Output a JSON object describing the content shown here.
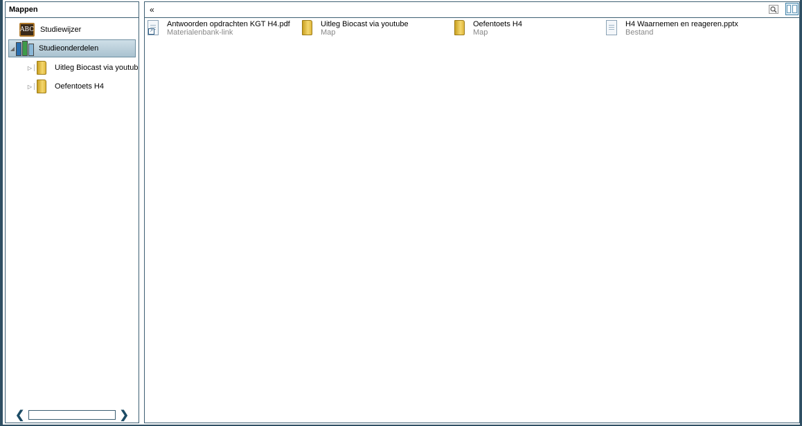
{
  "left_pane": {
    "title": "Mappen",
    "tree": {
      "root1": {
        "label": "Studiewijzer",
        "icon": "abc-board-icon",
        "icon_text": "ABC"
      },
      "root2": {
        "label": "Studieonderdelen",
        "icon": "books-icon",
        "selected": true,
        "expanded": true
      },
      "children": [
        {
          "label": "Uitleg Biocast via youtube",
          "icon": "folder-icon"
        },
        {
          "label": "Oefentoets H4",
          "icon": "folder-icon"
        }
      ]
    },
    "scrollbar": {
      "left_arrow": "❮",
      "right_arrow": "❯"
    }
  },
  "right_pane": {
    "collapse_label": "«",
    "toolbar_icons": [
      "search-icon",
      "layout-toggle-icon"
    ],
    "items": [
      {
        "name": "Antwoorden opdrachten KGT H4.pdf",
        "type": "Materialenbank-link",
        "icon": "document-link-icon"
      },
      {
        "name": "Uitleg Biocast via youtube",
        "type": "Map",
        "icon": "folder-icon"
      },
      {
        "name": "Oefentoets H4",
        "type": "Map",
        "icon": "folder-icon"
      },
      {
        "name": "H4 Waarnemen en reageren.pptx",
        "type": "Bestand",
        "icon": "document-icon"
      }
    ]
  },
  "colors": {
    "frame": "#2f4f63",
    "selected_bg": "#b9cfdb",
    "folder": "#e7c14a",
    "secondary_text": "#888888"
  }
}
